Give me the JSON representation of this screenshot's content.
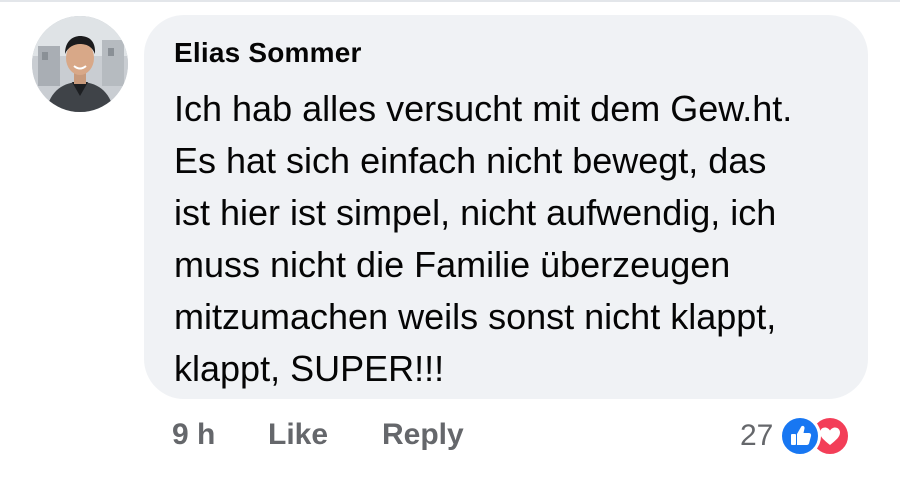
{
  "comment": {
    "author": "Elias Sommer",
    "text": "Ich hab alles versucht mit dem Gew.ht.\nEs hat sich einfach nicht bewegt, das\nist hier ist simpel, nicht aufwendig, ich\nmuss nicht die Familie überzeugen\nmitzumachen weils sonst nicht klappt,\nklappt, SUPER!!!",
    "avatar_icon": "profile-photo",
    "colors": {
      "bubble": "#f0f2f5",
      "text": "#050505",
      "meta": "#65676b",
      "like_blue": "#1877f2",
      "love_red": "#f33e58"
    }
  },
  "actions": {
    "timestamp": "9 h",
    "like_label": "Like",
    "reply_label": "Reply"
  },
  "reactions": {
    "count": "27",
    "icons": [
      "thumbs-up-icon",
      "heart-icon"
    ]
  }
}
